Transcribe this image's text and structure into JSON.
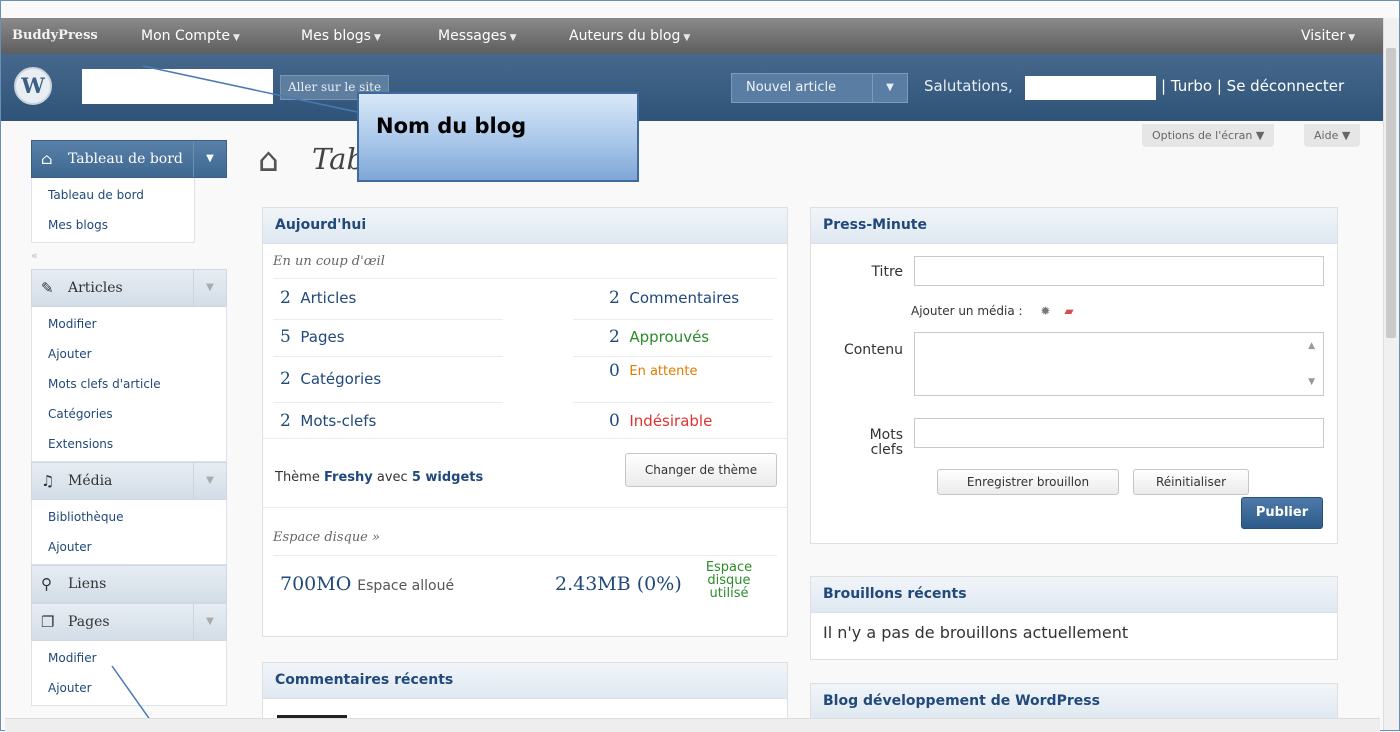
{
  "adminbar": {
    "brand": "BuddyPress",
    "menus": [
      "Mon Compte",
      "Mes blogs",
      "Messages",
      "Auteurs du blog"
    ],
    "visit": "Visiter"
  },
  "header": {
    "logo_glyph": "W",
    "visit_site": "Aller sur le site",
    "new_post": "Nouvel article",
    "greeting": "Salutations,",
    "links": "| Turbo | Se déconnecter"
  },
  "callout": {
    "label": "Nom du blog"
  },
  "screen": {
    "options": "Options de l'écran",
    "help": "Aide"
  },
  "sidebar": {
    "dashboard": {
      "label": "Tableau de bord",
      "items": [
        "Tableau de bord",
        "Mes blogs"
      ]
    },
    "articles": {
      "label": "Articles",
      "items": [
        "Modifier",
        "Ajouter",
        "Mots clefs d'article",
        "Catégories",
        "Extensions"
      ]
    },
    "media": {
      "label": "Média",
      "items": [
        "Bibliothèque",
        "Ajouter"
      ]
    },
    "links": {
      "label": "Liens"
    },
    "pages": {
      "label": "Pages",
      "items": [
        "Modifier",
        "Ajouter"
      ]
    }
  },
  "page_title": "Tableau de bord",
  "today": {
    "title": "Aujourd'hui",
    "subtitle": "En un coup d'œil",
    "left": [
      {
        "n": "2",
        "label": "Articles"
      },
      {
        "n": "5",
        "label": "Pages"
      },
      {
        "n": "2",
        "label": "Catégories"
      },
      {
        "n": "2",
        "label": "Mots-clefs"
      }
    ],
    "right": [
      {
        "n": "2",
        "label": "Commentaires",
        "color": "#21497a"
      },
      {
        "n": "2",
        "label": "Approuvés",
        "color": "#2a8c2a"
      },
      {
        "n": "0",
        "label": "En attente",
        "color": "#e07b00"
      },
      {
        "n": "0",
        "label": "Indésirable",
        "color": "#e0322f"
      }
    ],
    "theme_prefix": "Thème",
    "theme_name": "Freshy",
    "theme_with": "avec",
    "theme_widgets": "5 widgets",
    "change_theme": "Changer de thème",
    "disk_label": "Espace disque »",
    "allowed_value": "700MO",
    "allowed_text": "Espace alloué",
    "used_value": "2.43MB (0%)",
    "used_text": "Espace disque utilisé"
  },
  "recent_comments": {
    "title": "Commentaires récents"
  },
  "press_minute": {
    "title": "Press-Minute",
    "title_label": "Titre",
    "media_label": "Ajouter un média :",
    "content_label": "Contenu",
    "tags_label": "Mots clefs",
    "save_draft": "Enregistrer brouillon",
    "reset": "Réinitialiser",
    "publish": "Publier"
  },
  "drafts": {
    "title": "Brouillons récents",
    "empty": "Il n'y a pas de brouillons actuellement"
  },
  "wp_dev_blog": {
    "title": "Blog développement de WordPress"
  }
}
